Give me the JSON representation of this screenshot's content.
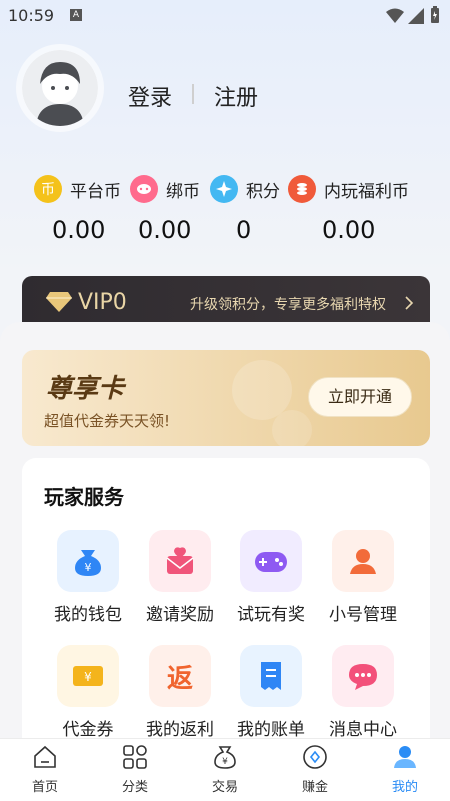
{
  "status_bar": {
    "time": "10:59",
    "notif_letter": "A"
  },
  "profile": {
    "login": "登录",
    "register": "注册"
  },
  "balances": [
    {
      "label": "平台币",
      "value": "0.00",
      "icon": "coin-icon",
      "color": "#f4c21b",
      "glyph": "币"
    },
    {
      "label": "绑币",
      "value": "0.00",
      "icon": "bind-coin-icon",
      "color": "#ff6b8d",
      "glyph": ""
    },
    {
      "label": "积分",
      "value": "0",
      "icon": "points-icon",
      "color": "#43b8f2",
      "glyph": ""
    },
    {
      "label": "内玩福利币",
      "value": "0.00",
      "icon": "welfare-coin-icon",
      "color": "#f05a3a",
      "glyph": ""
    }
  ],
  "vip": {
    "title": "VIP0",
    "desc": "升级领积分，专享更多福利特权"
  },
  "card": {
    "title": "尊享卡",
    "subtitle": "超值代金券天天领!",
    "button": "立即开通"
  },
  "services": {
    "title": "玩家服务",
    "items": [
      {
        "label": "我的钱包",
        "icon": "wallet-icon",
        "bg": "#e7f2ff",
        "fg": "#2f86f5"
      },
      {
        "label": "邀请奖励",
        "icon": "invite-icon",
        "bg": "#ffecef",
        "fg": "#f0557a"
      },
      {
        "label": "试玩有奖",
        "icon": "gamepad-icon",
        "bg": "#f1ecff",
        "fg": "#8e5af2"
      },
      {
        "label": "小号管理",
        "icon": "user-icon",
        "bg": "#fff0ea",
        "fg": "#f26b3a"
      },
      {
        "label": "代金券",
        "icon": "voucher-icon",
        "bg": "#fff6e3",
        "fg": "#f4b41c"
      },
      {
        "label": "我的返利",
        "icon": "rebate-icon",
        "bg": "#fff0ea",
        "fg": "#f0642e",
        "glyph": "返"
      },
      {
        "label": "我的账单",
        "icon": "bill-icon",
        "bg": "#e8f3ff",
        "fg": "#2f86f5"
      },
      {
        "label": "消息中心",
        "icon": "message-icon",
        "bg": "#ffecf1",
        "fg": "#f3507a"
      }
    ]
  },
  "nav": [
    {
      "label": "首页",
      "icon": "home-icon",
      "active": false
    },
    {
      "label": "分类",
      "icon": "category-icon",
      "active": false
    },
    {
      "label": "交易",
      "icon": "trade-icon",
      "active": false
    },
    {
      "label": "赚金",
      "icon": "earn-icon",
      "active": false
    },
    {
      "label": "我的",
      "icon": "profile-icon",
      "active": true
    }
  ],
  "colors": {
    "accent": "#2a8cf5",
    "vip_gold": "#e9d5a6"
  }
}
